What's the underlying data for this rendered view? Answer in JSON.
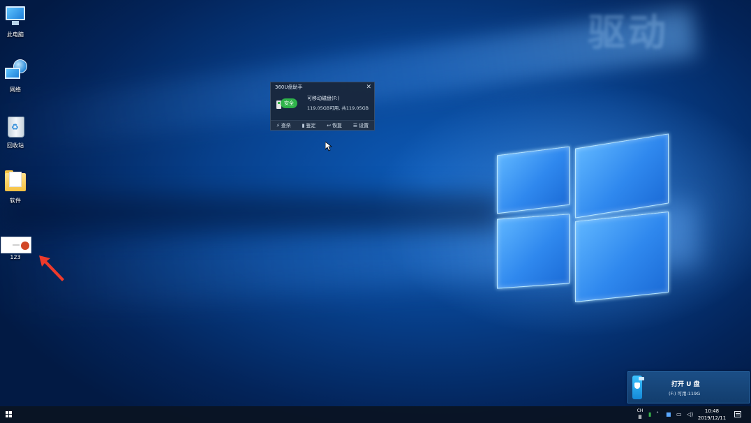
{
  "desktop": {
    "icons": [
      {
        "label": "此电脑",
        "icon": "computer-icon"
      },
      {
        "label": "网络",
        "icon": "network-icon"
      },
      {
        "label": "回收站",
        "icon": "recycle-bin-icon"
      },
      {
        "label": "软件",
        "icon": "folder-icon"
      },
      {
        "label": "123",
        "icon": "powerpoint-file-icon"
      }
    ],
    "watermark_text": "驱动"
  },
  "popup": {
    "title": "360U盘助手",
    "close_glyph": "✕",
    "safe_label": "安全",
    "drive_name": "可移动磁盘(F:)",
    "space_text": "119.05GB可用, 共119.05GB",
    "actions": [
      {
        "label": "查杀",
        "icon": "⚡"
      },
      {
        "label": "鉴定",
        "icon": "▮"
      },
      {
        "label": "恢复",
        "icon": "↩"
      },
      {
        "label": "设置",
        "icon": "☰"
      }
    ]
  },
  "toast": {
    "title": "打开 U 盘",
    "subtitle": "(F:)  可用:119G"
  },
  "taskbar": {
    "ime_top": "CH",
    "ime_bottom": "䷀",
    "clock_time": "10:48",
    "clock_date": "2019/12/11",
    "colors": {
      "accent": "#2fb34a",
      "taskbar": "#0a1422"
    }
  }
}
